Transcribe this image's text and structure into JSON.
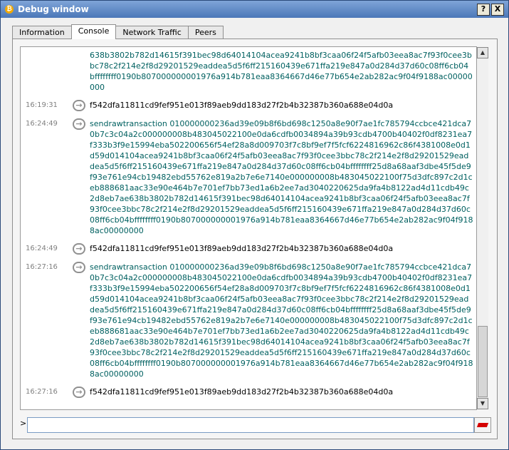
{
  "window": {
    "title": "Debug window",
    "help_label": "?",
    "close_label": "X"
  },
  "tabs": [
    {
      "label": "Information"
    },
    {
      "label": "Console"
    },
    {
      "label": "Network Traffic"
    },
    {
      "label": "Peers"
    }
  ],
  "console": {
    "prompt": ">",
    "input_value": "",
    "entries": [
      {
        "time": "",
        "type": "reply",
        "text": "638b3802b782d14615f391bec98d64014104acea9241b8bf3caa06f24f5afb03eea8ac7f93f0cee3bbc78c2f214e2f8d29201529eaddea5d5f6ff215160439e671ffa219e847a0d284d37d60c08ff6cb04bffffffff0190b807000000001976a914b781eaa8364667d46e77b654e2ab282ac9f04f9188ac00000000"
      },
      {
        "time": "16:19:31",
        "type": "cmd",
        "text": "f542dfa11811cd9fef951e013f89aeb9dd183d27f2b4b32387b360a688e04d0a"
      },
      {
        "time": "16:24:49",
        "type": "reply",
        "text": "sendrawtransaction 010000000236ad39e09b8f6bd698c1250a8e90f7ae1fc785794ccbce421dca70b7c3c04a2c000000008b483045022100e0da6cdfb0034894a39b93cdb4700b40402f0df8231ea7f333b3f9e15994eba502200656f54ef28a8d009703f7c8bf9ef7f5fcf6224816962c86f4381008e0d1d59d014104acea9241b8bf3caa06f24f5afb03eea8ac7f93f0cee3bbc78c2f214e2f8d29201529eaddea5d5f6ff215160439e671ffa219e847a0d284d37d60c08ff6cb04bffffffff25d8a68aaf3dbe45f5de9f93e761e94cb19482ebd55762e819a2b7e6e7140e000000008b483045022100f75d3dfc897c2d1ceb888681aac33e90e464b7e701ef7bb73ed1a6b2ee7ad3040220625da9fa4b8122ad4d11cdb49c2d8eb7ae638b3802b782d14615f391bec98d64014104acea9241b8bf3caa06f24f5afb03eea8ac7f93f0cee3bbc78c2f214e2f8d29201529eaddea5d5f6ff215160439e671ffa219e847a0d284d37d60c08ff6cb04bffffffff0190b807000000001976a914b781eaa8364667d46e77b654e2ab282ac9f04f9188ac00000000"
      },
      {
        "time": "16:24:49",
        "type": "cmd",
        "text": "f542dfa11811cd9fef951e013f89aeb9dd183d27f2b4b32387b360a688e04d0a"
      },
      {
        "time": "16:27:16",
        "type": "reply",
        "text": "sendrawtransaction 010000000236ad39e09b8f6bd698c1250a8e90f7ae1fc785794ccbce421dca70b7c3c04a2c000000008b483045022100e0da6cdfb0034894a39b93cdb4700b40402f0df8231ea7f333b3f9e15994eba502200656f54ef28a8d009703f7c8bf9ef7f5fcf6224816962c86f4381008e0d1d59d014104acea9241b8bf3caa06f24f5afb03eea8ac7f93f0cee3bbc78c2f214e2f8d29201529eaddea5d5f6ff215160439e671ffa219e847a0d284d37d60c08ff6cb04bffffffff25d8a68aaf3dbe45f5de9f93e761e94cb19482ebd55762e819a2b7e6e7140e000000008b483045022100f75d3dfc897c2d1ceb888681aac33e90e464b7e701ef7bb73ed1a6b2ee7ad3040220625da9fa4b8122ad4d11cdb49c2d8eb7ae638b3802b782d14615f391bec98d64014104acea9241b8bf3caa06f24f5afb03eea8ac7f93f0cee3bbc78c2f214e2f8d29201529eaddea5d5f6ff215160439e671ffa219e847a0d284d37d60c08ff6cb04bffffffff0190b807000000001976a914b781eaa8364667d46e77b654e2ab282ac9f04f9188ac00000000"
      },
      {
        "time": "16:27:16",
        "type": "cmd",
        "text": "f542dfa11811cd9fef951e013f89aeb9dd183d27f2b4b32387b360a688e04d0a"
      }
    ]
  },
  "icons": {
    "app": "bitcoin-icon",
    "entry": "arrow-icon",
    "clear": "eraser-icon"
  },
  "colors": {
    "reply_text": "#006060",
    "titlebar": "#4b77b8"
  }
}
